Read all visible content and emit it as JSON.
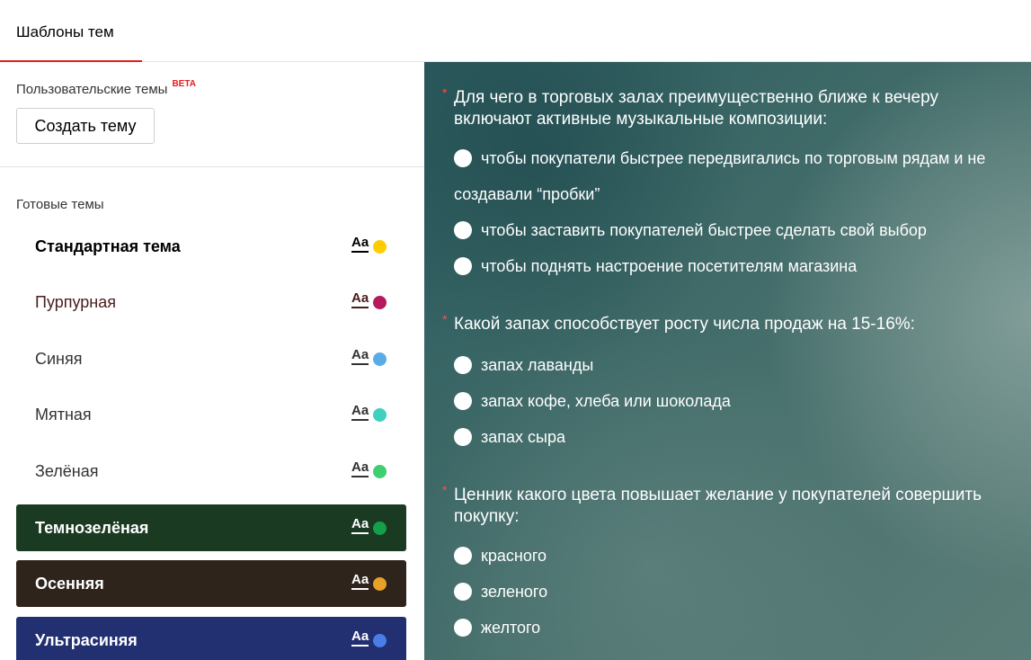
{
  "header": {
    "tab_label": "Шаблоны тем"
  },
  "sidebar": {
    "custom_title": "Пользовательские темы",
    "beta_badge": "BETA",
    "create_button": "Создать тему",
    "ready_title": "Готовые темы",
    "aa_label": "Aa",
    "themes": [
      {
        "name": "Стандартная тема",
        "bg": "#ffffff",
        "text": "#000000",
        "dot": "#ffcc00",
        "bold": true
      },
      {
        "name": "Пурпурная",
        "bg": "#ffffff",
        "text": "#4a1c1c",
        "dot": "#b5195e",
        "bold": false
      },
      {
        "name": "Синяя",
        "bg": "#ffffff",
        "text": "#333333",
        "dot": "#5aace8",
        "bold": false
      },
      {
        "name": "Мятная",
        "bg": "#ffffff",
        "text": "#333333",
        "dot": "#40d0bf",
        "bold": false
      },
      {
        "name": "Зелёная",
        "bg": "#ffffff",
        "text": "#333333",
        "dot": "#3fce70",
        "bold": false
      },
      {
        "name": "Темнозелёная",
        "bg": "#1b3a22",
        "text": "#ffffff",
        "dot": "#14a04a",
        "bold": true
      },
      {
        "name": "Осенняя",
        "bg": "#2e241c",
        "text": "#ffffff",
        "dot": "#e6a126",
        "bold": true
      },
      {
        "name": "Ультрасиняя",
        "bg": "#223071",
        "text": "#ffffff",
        "dot": "#4a7de8",
        "bold": true
      }
    ]
  },
  "preview": {
    "required_mark": "*",
    "questions": [
      {
        "title": "Для чего в торговых залах преимущественно ближе к вечеру включают активные музыкальные композиции:",
        "options": [
          "чтобы покупатели быстрее передвигались по торговым рядам и не",
          "создавали “пробки”",
          "чтобы заставить покупателей быстрее сделать свой выбор",
          "чтобы поднять настроение посетителям магазина"
        ]
      },
      {
        "title": "Какой запах способствует росту числа продаж на 15-16%:",
        "options": [
          "запах лаванды",
          "запах кофе, хлеба или шоколада",
          "запах сыра"
        ]
      },
      {
        "title": "Ценник какого цвета повышает желание у покупателей совершить покупку:",
        "options": [
          "красного",
          "зеленого",
          "желтого"
        ]
      }
    ]
  }
}
